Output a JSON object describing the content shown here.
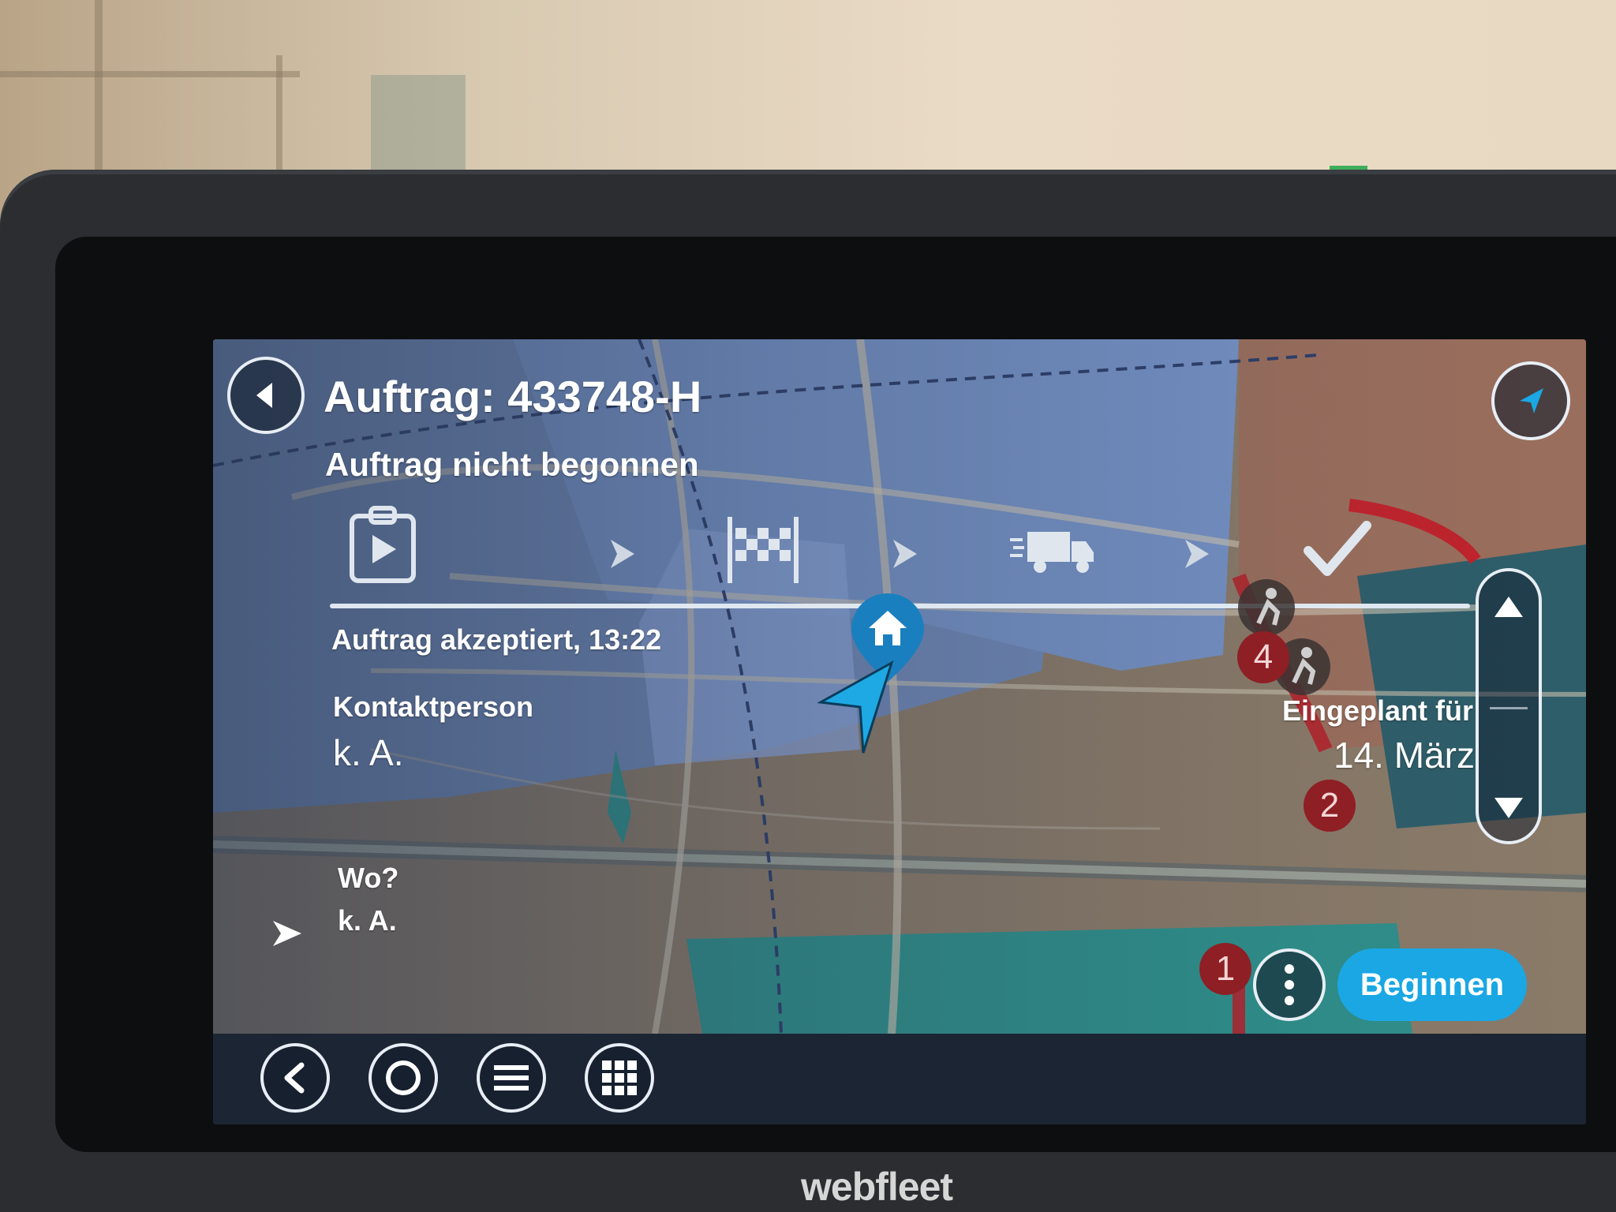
{
  "header": {
    "title": "Auftrag: 433748-H",
    "status": "Auftrag nicht begonnen"
  },
  "steps": [
    {
      "icon": "clipboard-play-icon"
    },
    {
      "icon": "checkered-flag-icon"
    },
    {
      "icon": "delivery-truck-icon"
    },
    {
      "icon": "checkmark-icon"
    }
  ],
  "details": {
    "accepted": "Auftrag akzeptiert, 13:22",
    "contact_label": "Kontaktperson",
    "contact_value": "k. A.",
    "where_label": "Wo?",
    "where_value": "k. A.",
    "scheduled_label": "Eingeplant für",
    "scheduled_value": "14. März"
  },
  "actions": {
    "begin_label": "Beginnen"
  },
  "map_markers": [
    "4",
    "2",
    "1"
  ],
  "bottom_nav": [
    {
      "icon": "back-chevron-icon"
    },
    {
      "icon": "circle-home-icon"
    },
    {
      "icon": "hamburger-menu-icon"
    },
    {
      "icon": "app-grid-icon"
    }
  ],
  "device": {
    "brand": "webfleet"
  },
  "colors": {
    "accent": "#1aa7e4",
    "route": "#b3232b",
    "map_water": "#2f8f8a",
    "map_land": "#a08a6e"
  }
}
